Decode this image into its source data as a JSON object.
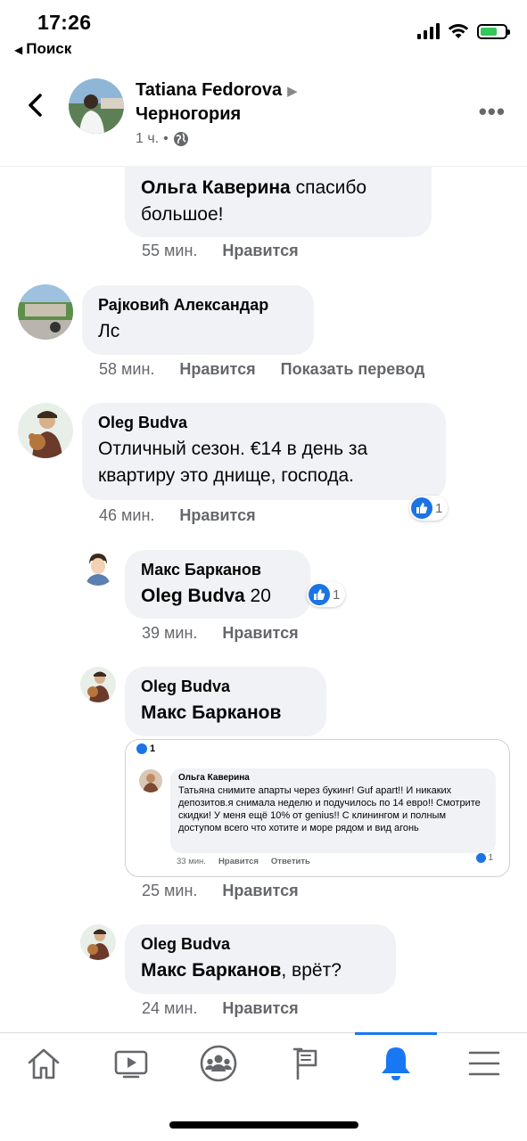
{
  "status_bar": {
    "time": "17:26",
    "back_label": "Поиск",
    "icons": [
      "signal-icon",
      "wifi-icon",
      "battery-charging-icon"
    ]
  },
  "header": {
    "author": "Tatiana Fedorova",
    "location": "Черногория",
    "time_ago": "1 ч.",
    "separator": "•",
    "privacy_icon": "globe-icon"
  },
  "comments": [
    {
      "id": "olga",
      "author": "Ольга Каверина",
      "text": "спасибо большое!",
      "time": "55 мин.",
      "like_label": "Нравится"
    },
    {
      "id": "rajkovic",
      "author": "Рајковић Александар",
      "text": "Лс",
      "time": "58 мин.",
      "like_label": "Нравится",
      "translate_label": "Показать перевод"
    },
    {
      "id": "oleg1",
      "author": "Oleg Budva",
      "text": "Отличный сезон. €14 в день за квартиру это днище, господа.",
      "time": "46 мин.",
      "like_label": "Нравится",
      "reactions": "1"
    },
    {
      "id": "maks",
      "author": "Макс Барканов",
      "mention": "Oleg Budva",
      "text": " 20",
      "time": "39 мин.",
      "like_label": "Нравится",
      "reactions": "1"
    },
    {
      "id": "oleg2",
      "author": "Oleg Budva",
      "mention": "Макс Барканов",
      "time": "25 мин.",
      "like_label": "Нравится",
      "embed": {
        "top_reactions": "1",
        "author": "Ольга Каверина",
        "text": "Татьяна снимите апарты через букинг! Guf apart!! И никаких депозитов.я снимала неделю и подучилось по 14 евро!! Смотрите скидки! У меня ещё 10% от genius!! С клинингом и полным доступом всего что хотите и море рядом и вид агонь",
        "time": "33 мин.",
        "like_label": "Нравится",
        "reply_label": "Ответить",
        "reactions": "1"
      }
    },
    {
      "id": "oleg3",
      "author": "Oleg Budva",
      "mention": "Макс Барканов",
      "text": ", врёт?",
      "time": "24 мин.",
      "like_label": "Нравится"
    }
  ],
  "bottom_nav": {
    "items": [
      "home-icon",
      "watch-icon",
      "groups-icon",
      "pages-flag-icon",
      "notifications-bell-icon",
      "menu-icon"
    ],
    "active": "notifications-bell-icon"
  },
  "colors": {
    "accent": "#1877f2",
    "bubble": "#f0f2f5",
    "secondary_text": "#65676b",
    "like_badge": "#1b74e4"
  }
}
